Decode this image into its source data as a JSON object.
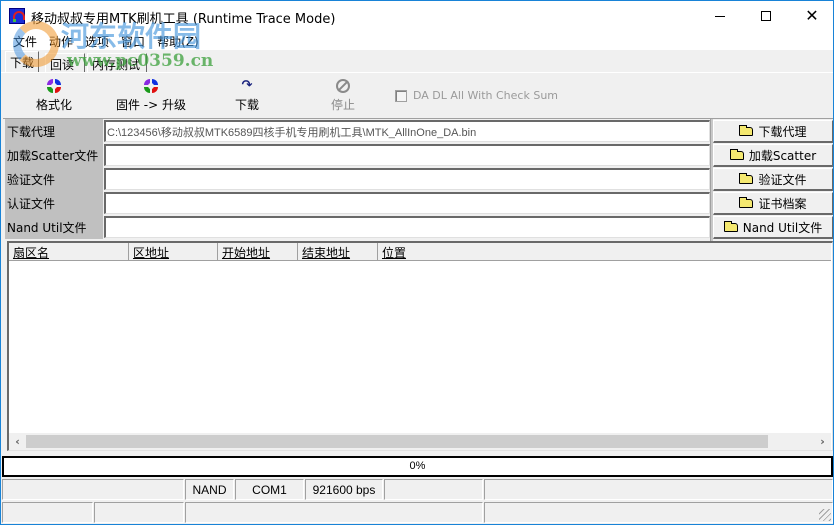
{
  "window": {
    "title": "移动叔叔专用MTK刷机工具 (Runtime Trace Mode)",
    "controls": {
      "minimize": "—",
      "maximize": "☐",
      "close": "✕"
    }
  },
  "menu": [
    "文件",
    "动作",
    "选项",
    "窗口",
    "帮助(Z)"
  ],
  "tabs": [
    {
      "label": "下载",
      "active": true
    },
    {
      "label": "回读",
      "active": false
    },
    {
      "label": "内存测试",
      "active": false
    }
  ],
  "toolbar": {
    "buttons": [
      {
        "label": "格式化",
        "icon": "format-cycle-icon",
        "enabled": true
      },
      {
        "label": "固件 -> 升级",
        "icon": "firmware-upgrade-icon",
        "enabled": true
      },
      {
        "label": "下载",
        "icon": "download-arrow-icon",
        "enabled": true
      },
      {
        "label": "停止",
        "icon": "stop-icon",
        "enabled": false
      }
    ],
    "checksum_label": "DA DL All With Check Sum",
    "checksum_checked": false
  },
  "files": [
    {
      "label": "下载代理",
      "value": "C:\\123456\\移动叔叔MTK6589四核手机专用刷机工具\\MTK_AllInOne_DA.bin",
      "button": "下载代理"
    },
    {
      "label": "加载Scatter文件",
      "value": "",
      "button": "加载Scatter"
    },
    {
      "label": "验证文件",
      "value": "",
      "button": "验证文件"
    },
    {
      "label": "认证文件",
      "value": "",
      "button": "证书档案"
    },
    {
      "label": "Nand Util文件",
      "value": "",
      "button": "Nand Util文件"
    }
  ],
  "list": {
    "columns": [
      "扇区名",
      "区地址",
      "开始地址",
      "结束地址",
      "位置"
    ],
    "rows": []
  },
  "progress": {
    "percent": 0,
    "label": "0%"
  },
  "status_bar": {
    "row1": [
      "",
      "NAND",
      "COM1",
      "921600 bps",
      "",
      ""
    ],
    "row2": [
      "",
      "",
      "",
      ""
    ]
  },
  "watermark": {
    "title": "河东软件园",
    "url": "www.pc0359.cn"
  }
}
